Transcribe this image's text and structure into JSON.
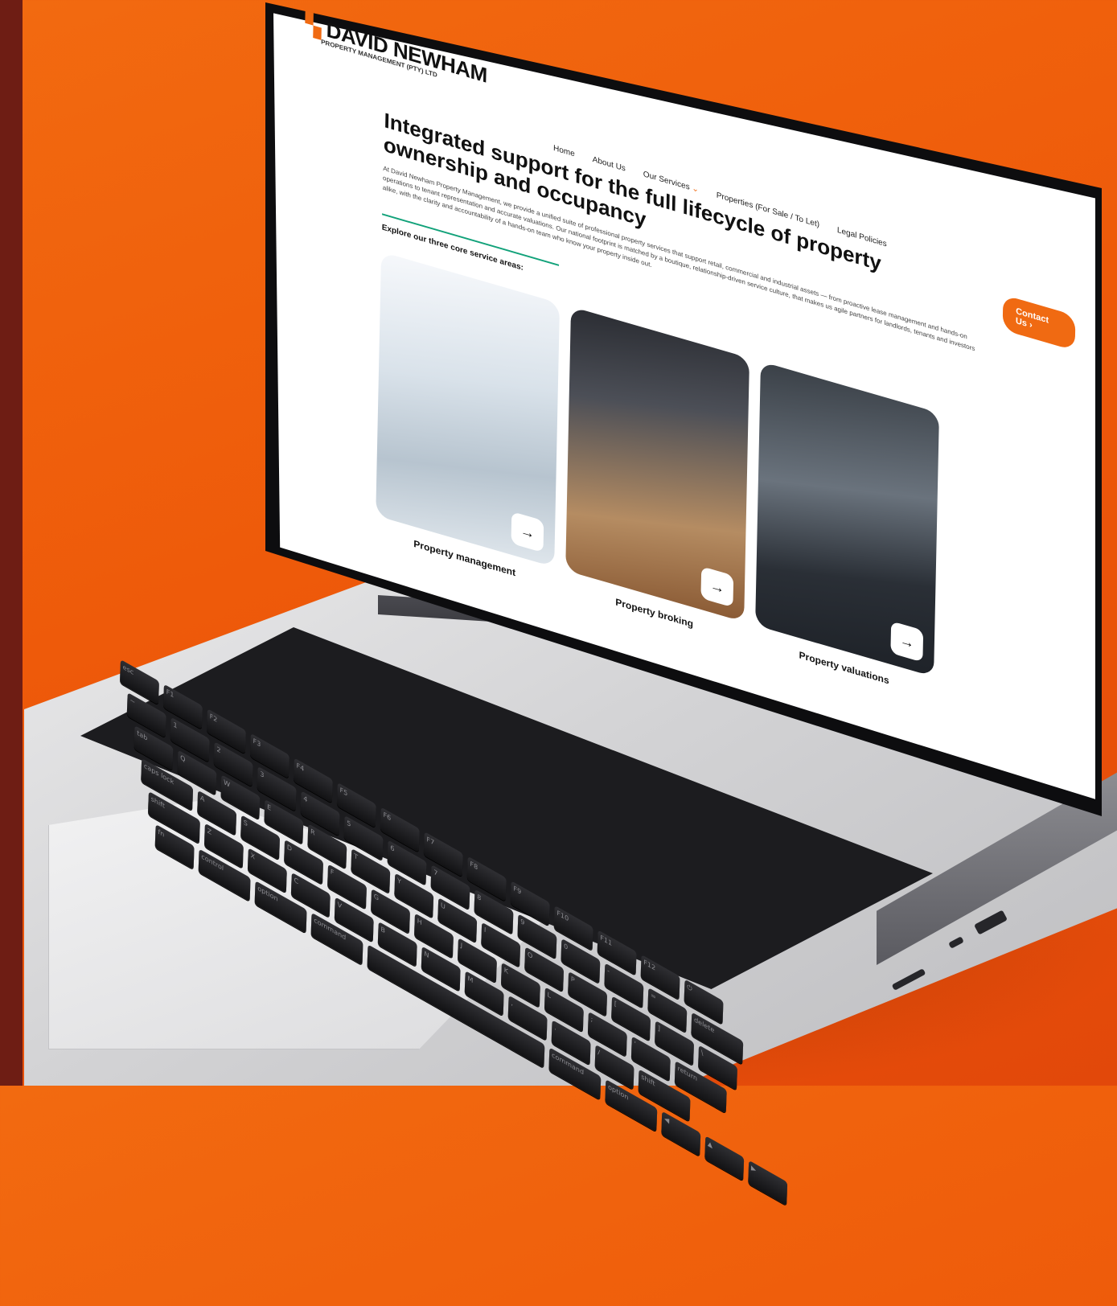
{
  "brand": {
    "logo_text": "DAVID NEWHAM",
    "logo_sub": "PROPERTY MANAGEMENT (PTY) LTD"
  },
  "breadcrumb": "",
  "nav": {
    "items": [
      {
        "label": "Home"
      },
      {
        "label": "About Us"
      },
      {
        "label": "Our Services"
      },
      {
        "label": "Properties (For Sale / To Let)"
      },
      {
        "label": "Legal Policies"
      }
    ],
    "cta_label": "Contact Us"
  },
  "hero": {
    "headline": "Integrated support for the full lifecycle of property ownership and occupancy",
    "intro": "At David Newham Property Management, we provide a unified suite of professional property services that support retail, commercial and industrial assets — from proactive lease management and hands-on operations to tenant representation and accurate valuations. Our national footprint is matched by a boutique, relationship-driven service culture, that makes us agile partners for landlords, tenants and investors alike, with the clarity and accountability of a hands-on team who know your property inside out.",
    "explore_label": "Explore our three core service areas:"
  },
  "cards": [
    {
      "label": "Property management",
      "image": "retail-mall-photo",
      "arrow": "arrow-right-icon"
    },
    {
      "label": "Property broking",
      "image": "office-interior-photo",
      "arrow": "arrow-right-icon"
    },
    {
      "label": "Property valuations",
      "image": "business-men-photo",
      "arrow": "arrow-right-icon"
    }
  ],
  "keyboard": {
    "rows": [
      [
        "esc",
        "F1",
        "F2",
        "F3",
        "F4",
        "F5",
        "F6",
        "F7",
        "F8",
        "F9",
        "F10",
        "F11",
        "F12",
        "⏻"
      ],
      [
        "~",
        "1",
        "2",
        "3",
        "4",
        "5",
        "6",
        "7",
        "8",
        "9",
        "0",
        "-",
        "=",
        "delete"
      ],
      [
        "tab",
        "Q",
        "W",
        "E",
        "R",
        "T",
        "Y",
        "U",
        "I",
        "O",
        "P",
        "[",
        "]",
        "\\"
      ],
      [
        "caps lock",
        "A",
        "S",
        "D",
        "F",
        "G",
        "H",
        "J",
        "K",
        "L",
        ";",
        "'",
        "return"
      ],
      [
        "shift",
        "Z",
        "X",
        "C",
        "V",
        "B",
        "N",
        "M",
        ",",
        ".",
        "/",
        "shift"
      ],
      [
        "fn",
        "control",
        "option",
        "command",
        "",
        "command",
        "option",
        "◀",
        "▲",
        "▶"
      ]
    ]
  },
  "colors": {
    "background": "#ee5a0a",
    "accent_orange": "#f06a12",
    "accent_green": "#12a27a",
    "side_strip": "#6e1d14"
  }
}
